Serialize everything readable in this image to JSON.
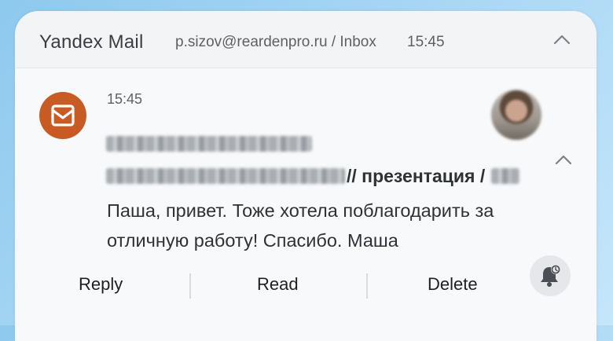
{
  "header": {
    "app_name": "Yandex Mail",
    "account": "p.sizov@reardenpro.ru / Inbox",
    "time": "15:45"
  },
  "message": {
    "time": "15:45",
    "subject_visible": "// презентация /",
    "body": "Паша, привет. Тоже хотела поблагодарить за отличную работу! Спасибо. Маша"
  },
  "actions": {
    "reply": "Reply",
    "read": "Read",
    "delete": "Delete"
  },
  "icons": {
    "app": "mail-envelope-icon",
    "collapse": "chevron-up-icon",
    "snooze": "bell-snooze-icon"
  },
  "colors": {
    "app_icon": "#c85a24",
    "background": "#f3f4f6"
  }
}
